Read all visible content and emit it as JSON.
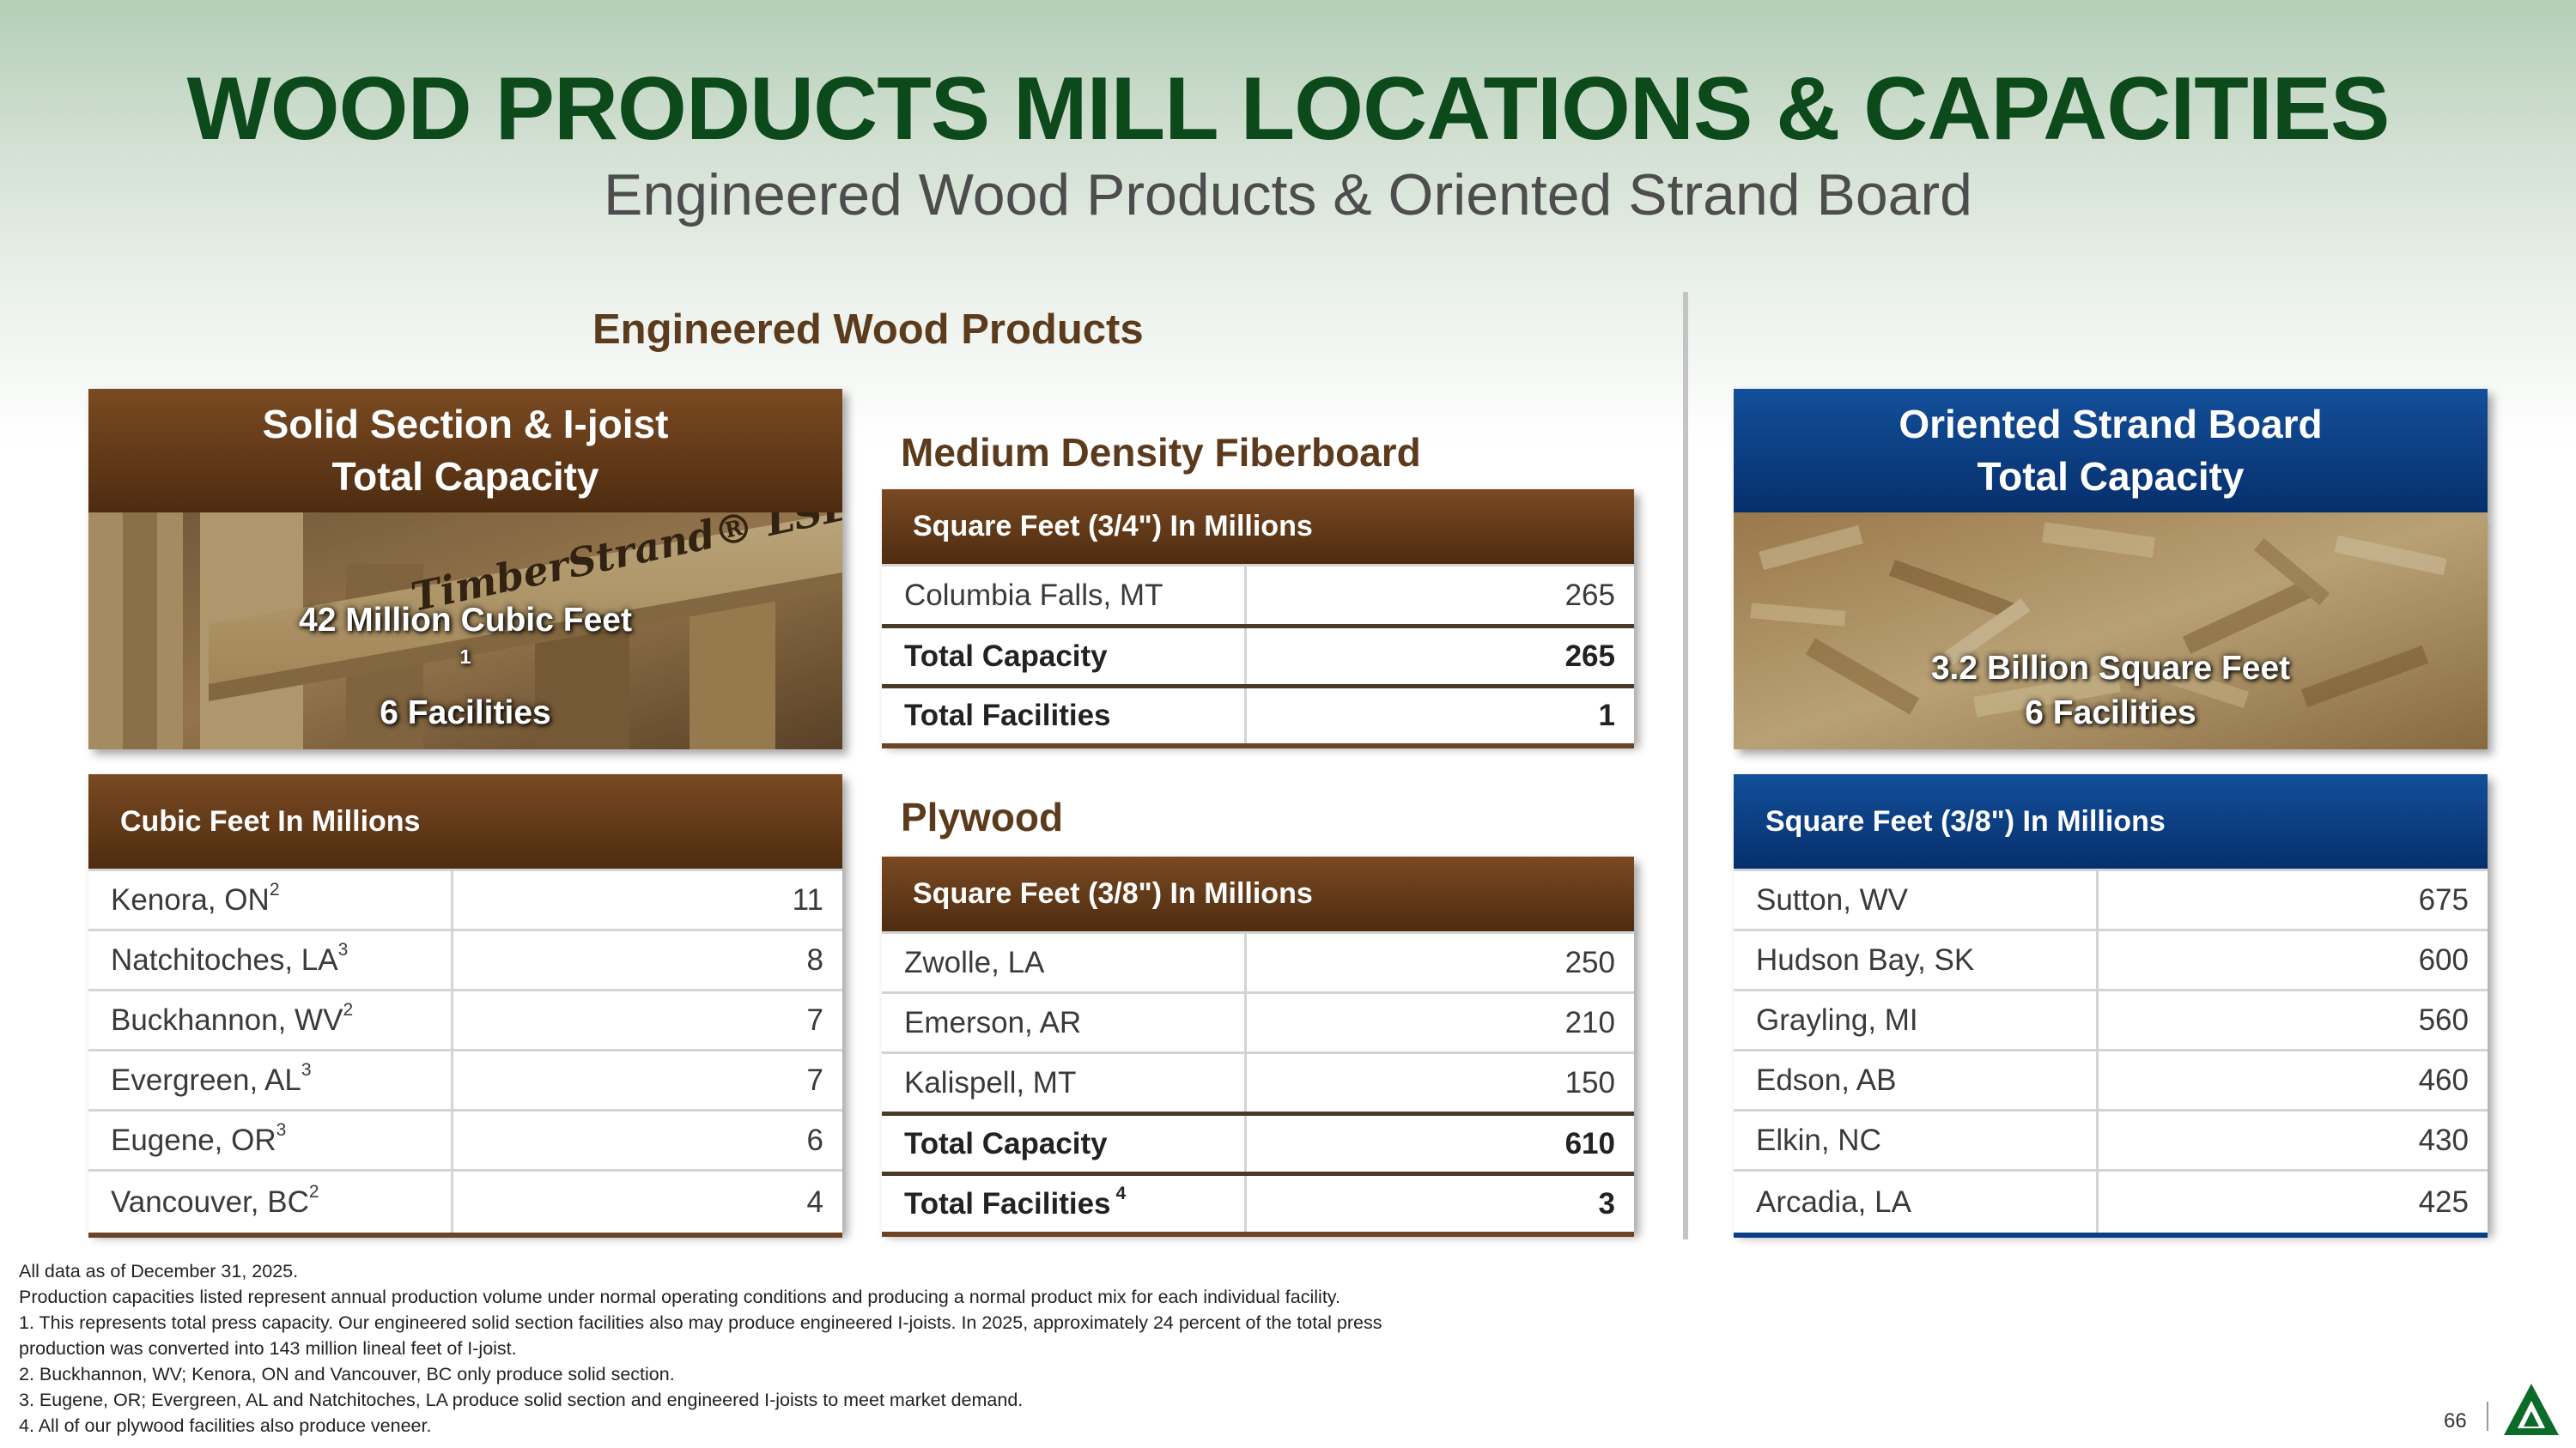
{
  "title": "WOOD PRODUCTS MILL LOCATIONS & CAPACITIES",
  "subtitle": "Engineered Wood Products & Oriented Strand Board",
  "ewp_heading": "Engineered Wood Products",
  "solid_section": {
    "header_line1": "Solid Section & I-joist",
    "header_line2": "Total Capacity",
    "capacity": "42 Million Cubic Feet",
    "capacity_note": "1",
    "facilities": "6 Facilities",
    "image_label": "TimberStrand LSL wood beams photo",
    "table_header": "Cubic Feet In Millions",
    "rows": [
      {
        "location": "Kenora, ON",
        "note": "2",
        "value": "11"
      },
      {
        "location": "Natchitoches, LA",
        "note": "3",
        "value": "8"
      },
      {
        "location": "Buckhannon, WV",
        "note": "2",
        "value": "7"
      },
      {
        "location": "Evergreen, AL",
        "note": "3",
        "value": "7"
      },
      {
        "location": "Eugene, OR",
        "note": "3",
        "value": "6"
      },
      {
        "location": "Vancouver, BC",
        "note": "2",
        "value": "4"
      }
    ]
  },
  "mdf": {
    "heading": "Medium Density Fiberboard",
    "table_header": "Square Feet (3/4\") In Millions",
    "rows": [
      {
        "location": "Columbia Falls, MT",
        "value": "265"
      }
    ],
    "total_capacity_label": "Total Capacity",
    "total_capacity": "265",
    "total_facilities_label": "Total Facilities",
    "total_facilities": "1"
  },
  "plywood": {
    "heading": "Plywood",
    "table_header": "Square Feet (3/8\") In Millions",
    "rows": [
      {
        "location": "Zwolle, LA",
        "value": "250"
      },
      {
        "location": "Emerson, AR",
        "value": "210"
      },
      {
        "location": "Kalispell, MT",
        "value": "150"
      }
    ],
    "total_capacity_label": "Total Capacity",
    "total_capacity": "610",
    "total_facilities_label": "Total Facilities",
    "total_facilities_note": "4",
    "total_facilities": "3"
  },
  "osb": {
    "header_line1": "Oriented Strand Board",
    "header_line2": "Total Capacity",
    "capacity": "3.2 Billion Square Feet",
    "facilities": "6 Facilities",
    "image_label": "Oriented strand board texture photo",
    "table_header": "Square Feet (3/8\") In Millions",
    "rows": [
      {
        "location": "Sutton, WV",
        "value": "675"
      },
      {
        "location": "Hudson Bay, SK",
        "value": "600"
      },
      {
        "location": "Grayling, MI",
        "value": "560"
      },
      {
        "location": "Edson, AB",
        "value": "460"
      },
      {
        "location": "Elkin, NC",
        "value": "430"
      },
      {
        "location": "Arcadia, LA",
        "value": "425"
      }
    ]
  },
  "footnotes": [
    "All data as of December 31, 2025.",
    "Production capacities listed represent annual production volume under normal operating conditions and producing a normal product mix for each individual facility.",
    "1. This represents total press capacity. Our engineered solid section facilities also may produce engineered I-joists. In 2025, approximately 24 percent of the total press",
    "production was converted into 143 million lineal feet of I-joist.",
    "2. Buckhannon, WV; Kenora, ON and Vancouver, BC only produce solid section.",
    "3. Eugene, OR; Evergreen, AL and Natchitoches, LA produce solid section and engineered I-joists to meet market demand.",
    "4. All of our plywood facilities also produce veneer."
  ],
  "page_number": "66",
  "colors": {
    "title_green": "#0d4a1b",
    "brown_header": "#5c3416",
    "blue_header": "#0a3f88",
    "heading_brown": "#5c3b1c"
  }
}
